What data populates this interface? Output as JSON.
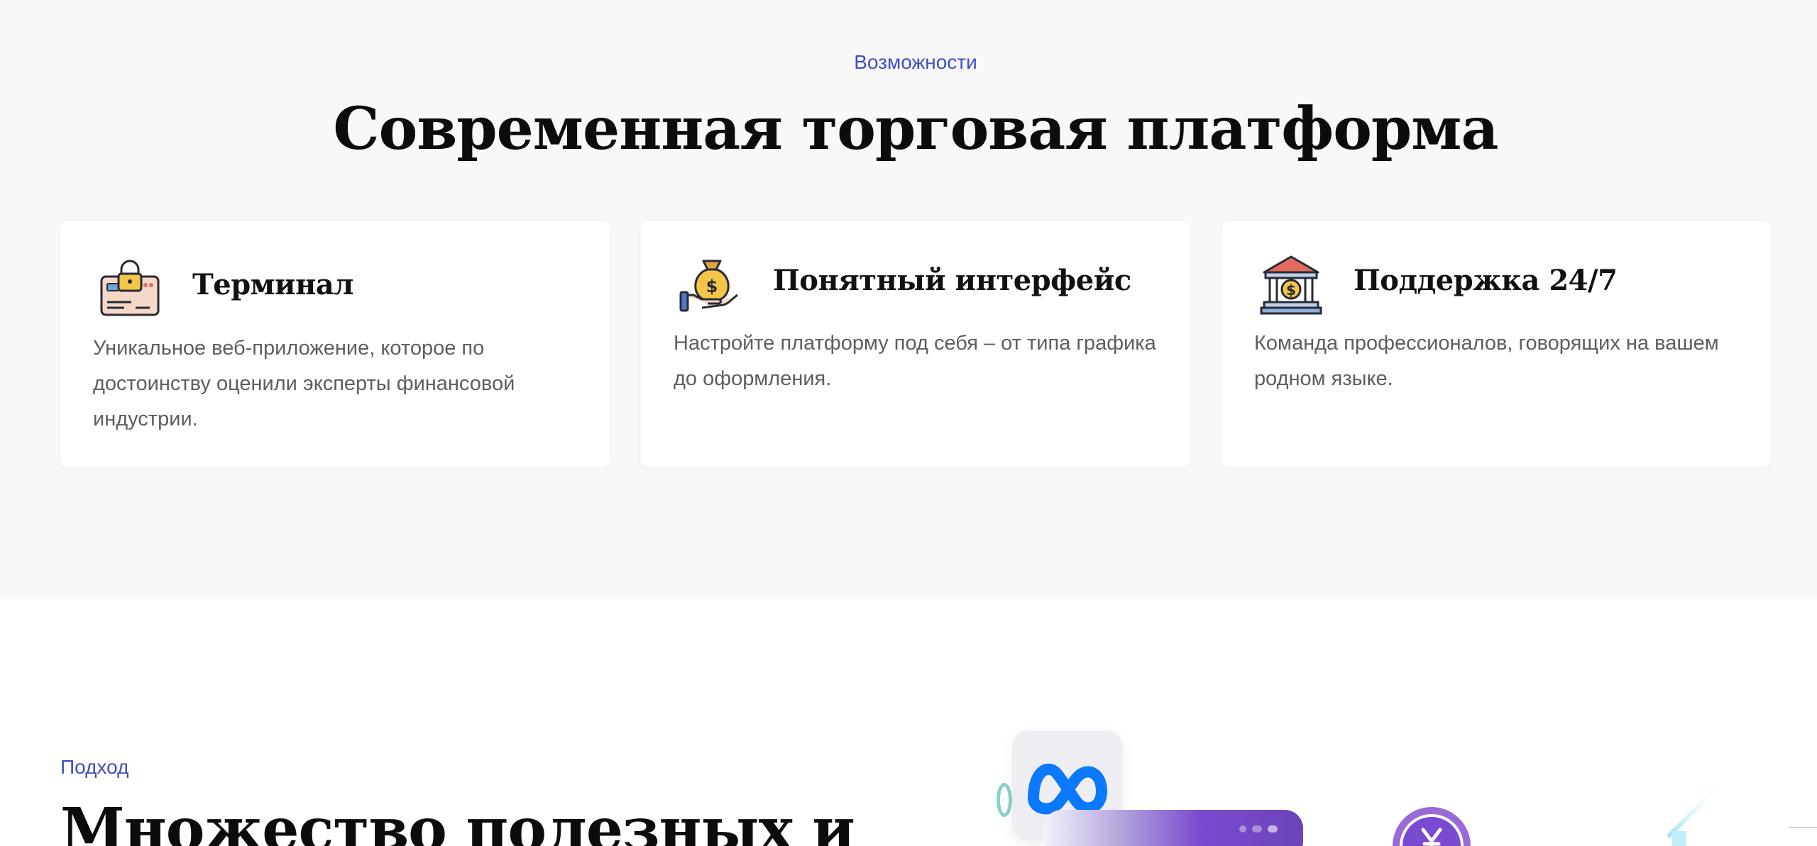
{
  "features": {
    "eyebrow": "Возможности",
    "title": "Современная торговая платформа",
    "cards": [
      {
        "icon": "credit-card-lock-icon",
        "title": "Терминал",
        "description": "Уникальное веб-приложение, которое по достоинству оценили эксперты финансовой индустрии."
      },
      {
        "icon": "money-bag-hand-icon",
        "title": "Понятный интерфейс",
        "description": "Настройте платформу под себя – от типа графика до оформления."
      },
      {
        "icon": "bank-building-icon",
        "title": "Поддержка 24/7",
        "description": "Команда профессионалов, говорящих на вашем родном языке."
      }
    ]
  },
  "approach": {
    "eyebrow": "Подход",
    "title": "Множество полезных и"
  },
  "colors": {
    "accent": "#3d4ec4",
    "section_bg": "#f8f8f9",
    "card_bg": "#ffffff",
    "text_body": "#5d5d62",
    "meta_blue": "#0a78ff",
    "purple": "#7a4bd0"
  }
}
